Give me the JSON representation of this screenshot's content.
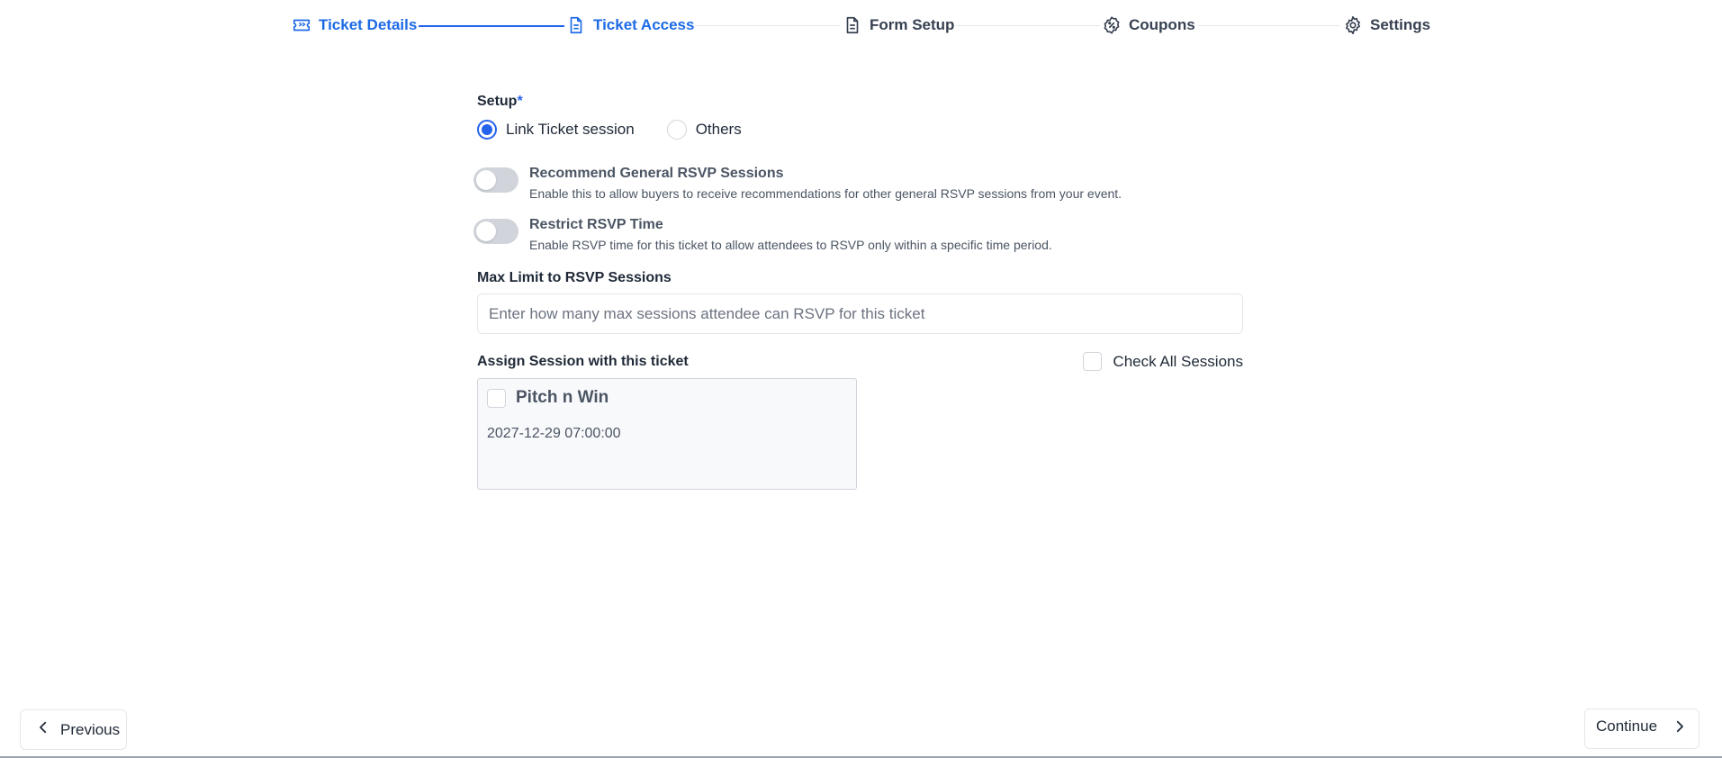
{
  "stepper": {
    "steps": [
      {
        "label": "Ticket Details",
        "icon": "ticket-icon",
        "state": "completed"
      },
      {
        "label": "Ticket Access",
        "icon": "document-icon",
        "state": "active"
      },
      {
        "label": "Form Setup",
        "icon": "document-icon",
        "state": "pending"
      },
      {
        "label": "Coupons",
        "icon": "discount-badge-icon",
        "state": "pending"
      },
      {
        "label": "Settings",
        "icon": "gear-icon",
        "state": "pending"
      }
    ]
  },
  "setup": {
    "label": "Setup",
    "required_mark": "*",
    "options": [
      {
        "label": "Link Ticket session",
        "checked": true
      },
      {
        "label": "Others",
        "checked": false
      }
    ]
  },
  "toggles": [
    {
      "title": "Recommend General RSVP Sessions",
      "description": "Enable this to allow buyers to receive recommendations for other general RSVP sessions from your event.",
      "on": false
    },
    {
      "title": "Restrict RSVP Time",
      "description": "Enable RSVP time for this ticket to allow attendees to RSVP only within a specific time period.",
      "on": false
    }
  ],
  "max_limit": {
    "label": "Max Limit to RSVP Sessions",
    "value": "",
    "placeholder": "Enter how many max sessions attendee can RSVP for this ticket"
  },
  "assign": {
    "label": "Assign Session with this ticket",
    "check_all_label": "Check All Sessions",
    "check_all_checked": false,
    "sessions": [
      {
        "title": "Pitch n Win",
        "datetime": "2027-12-29 07:00:00",
        "checked": false
      }
    ]
  },
  "footer": {
    "previous_label": "Previous",
    "continue_label": "Continue"
  },
  "colors": {
    "accent": "#2563eb",
    "active_step": "#1d6ae5",
    "text": "#1f2937",
    "muted": "#4b5563",
    "toggle_off": "#d1d5db"
  }
}
